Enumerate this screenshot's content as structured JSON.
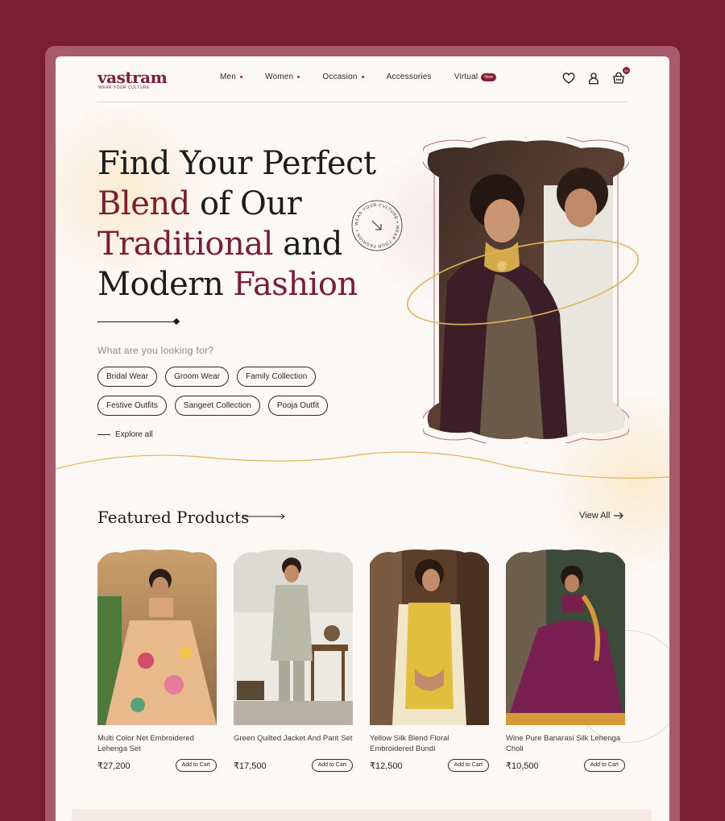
{
  "brand": {
    "name": "vastram",
    "tagline": "WEAR YOUR CULTURE"
  },
  "nav": {
    "items": [
      {
        "label": "Men",
        "dot": true
      },
      {
        "label": "Women",
        "dot": true
      },
      {
        "label": "Occasion",
        "dot": true
      },
      {
        "label": "Accessories",
        "dot": false
      },
      {
        "label": "Virtual",
        "badge": "New"
      }
    ]
  },
  "header_icons": [
    "heart-icon",
    "user-icon",
    "cart-icon"
  ],
  "cart_count": "04",
  "hero": {
    "line1": "Find Your Perfect",
    "line2_accent": "Blend",
    "line2_rest": "of Our",
    "line3_accent": "Traditional",
    "line3_rest": "and",
    "line4_plain": "Modern",
    "line4_accent": "Fashion",
    "badge_text": "WEAR YOUR CULTURE • WEAR YOUR FASHION •",
    "question": "What are you looking for?",
    "chips_row1": [
      "Bridal Wear",
      "Groom Wear",
      "Family Collection"
    ],
    "chips_row2": [
      "Festive Outfits",
      "Sangeet Collection",
      "Pooja Outfit"
    ],
    "explore": "Explore all"
  },
  "featured": {
    "title": "Featured Products",
    "view_all": "View All",
    "add_to_cart": "Add to Cart",
    "products": [
      {
        "name": "Multi Color Net Embroidered Lehenga Set",
        "price": "₹27,200"
      },
      {
        "name": "Green Quilted Jacket And Pant Set",
        "price": "₹17,500"
      },
      {
        "name": "Yellow Silk Blend Floral Embroidered Bundi",
        "price": "₹12,500"
      },
      {
        "name": "Wine Pure Banarasi Silk Lehenga Choli",
        "price": "₹10,500"
      }
    ]
  },
  "colors": {
    "brand": "#7a1f33",
    "accent_gold": "#e0b456",
    "background": "#fcf8f6"
  }
}
